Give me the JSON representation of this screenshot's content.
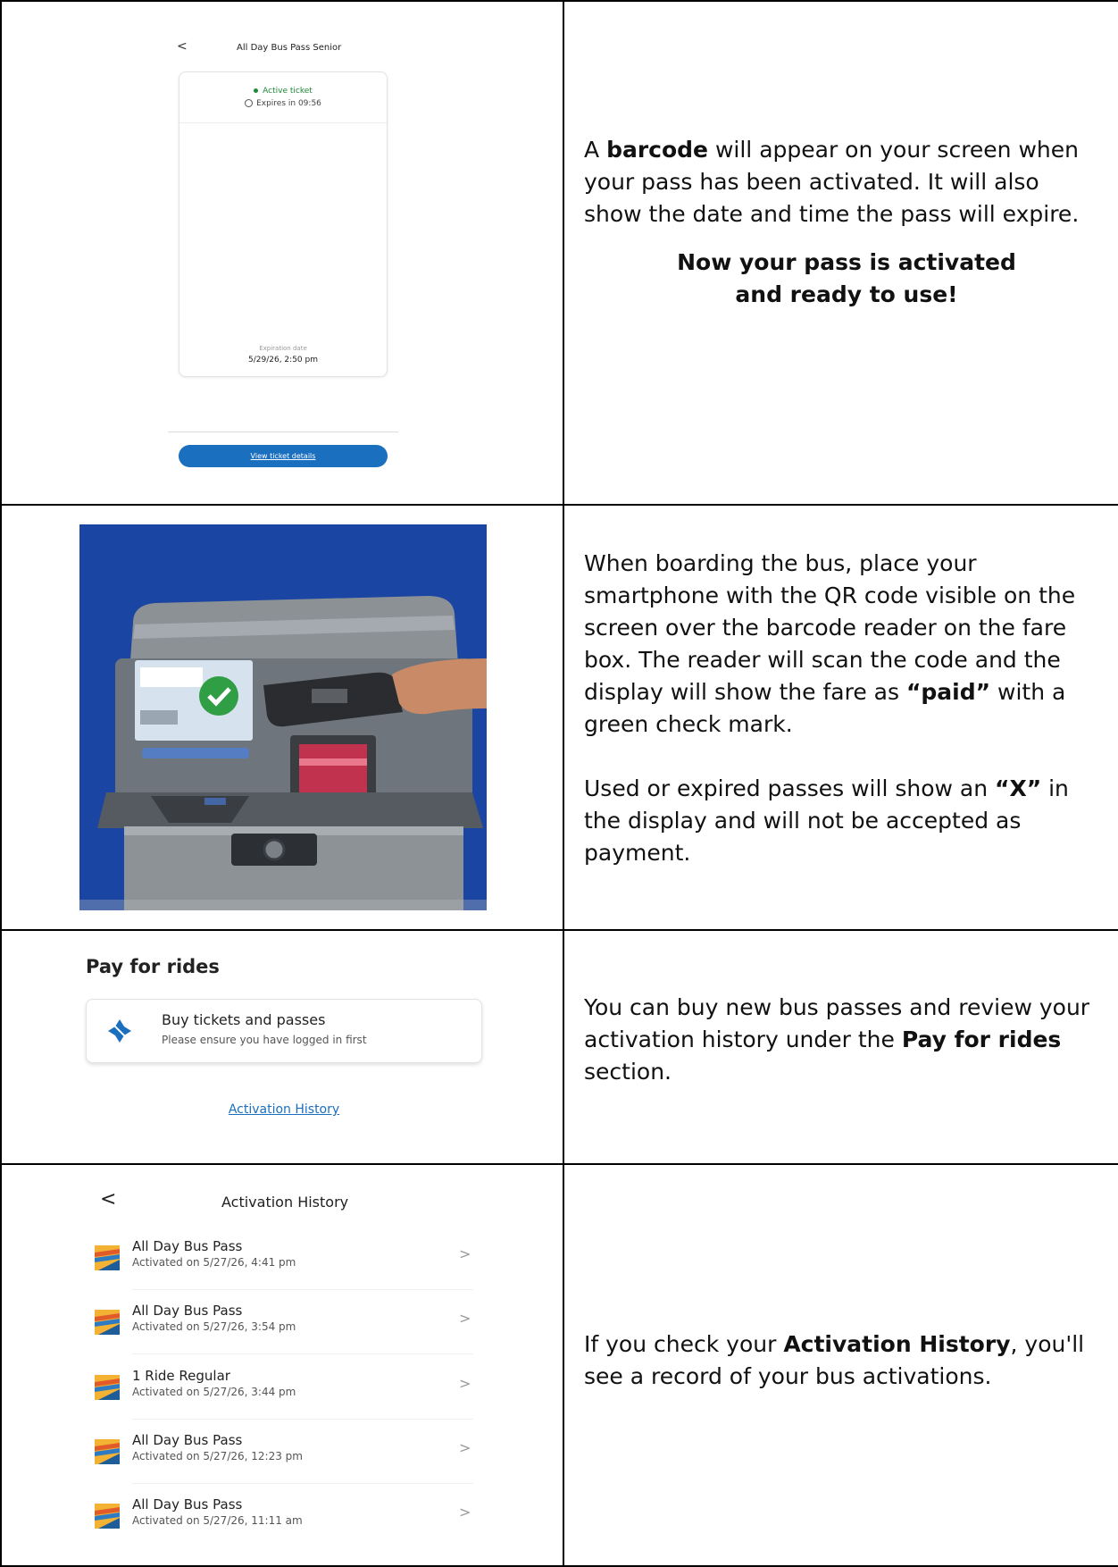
{
  "row1": {
    "phone": {
      "back": "<",
      "title": "All Day Bus Pass Senior",
      "status": "Active ticket",
      "expires": "Expires in 09:56",
      "expiration_label": "Expiration date",
      "expiration_value": "5/29/26, 2:50 pm",
      "button": "View ticket details"
    },
    "text": {
      "p1_a": "A ",
      "p1_b": "barcode",
      "p1_c": " will appear on your screen when your pass has been activated. It will also show the date and time the pass will expire.",
      "p2_line1": "Now your pass is activated",
      "p2_line2": "and ready to use!"
    }
  },
  "row2": {
    "text": {
      "p1_a": "When boarding the bus, place your smartphone with the QR code visible on the screen over the barcode reader on the fare box. The reader will scan the code and the display will show the fare as ",
      "p1_b": "“paid”",
      "p1_c": " with a green check mark.",
      "p2_a": "Used or expired passes will show an ",
      "p2_b": "“X”",
      "p2_c": " in the display and will not be accepted as payment."
    }
  },
  "row3": {
    "title": "Pay for rides",
    "card_title": "Buy tickets and passes",
    "card_subtitle": "Please ensure you have logged in first",
    "link": "Activation History",
    "text": {
      "a": "You can buy new bus passes and review your activation history under the ",
      "b": "Pay for rides",
      "c": " section."
    }
  },
  "row4": {
    "back": "<",
    "title": "Activation History",
    "items": [
      {
        "name": "All Day Bus Pass",
        "date": "Activated on 5/27/26, 4:41 pm"
      },
      {
        "name": "All Day Bus Pass",
        "date": "Activated on 5/27/26, 3:54 pm"
      },
      {
        "name": "1 Ride Regular",
        "date": "Activated on 5/27/26, 3:44 pm"
      },
      {
        "name": "All Day Bus Pass",
        "date": "Activated on 5/27/26, 12:23 pm"
      },
      {
        "name": "All Day Bus Pass",
        "date": "Activated on 5/27/26, 11:11 am"
      }
    ],
    "chevron": ">",
    "text": {
      "a": "If you check your ",
      "b": "Activation History",
      "c": ", you'll see a record of your bus activations."
    }
  },
  "colors": {
    "accent": "#1a6fbf",
    "active_green": "#1e8a3a",
    "photo_bg": "#1c49a8"
  }
}
